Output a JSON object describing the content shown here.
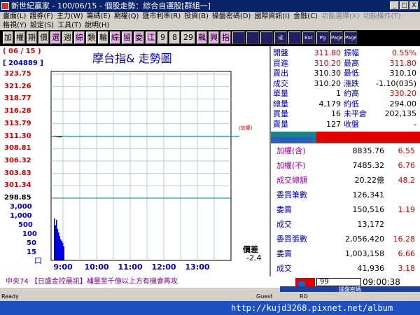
{
  "window": {
    "title": "新世紀贏家 - 100/06/15 - 個股走勢：綜合自選股[群組一]",
    "controls": [
      "_",
      "□",
      "X"
    ]
  },
  "menu_row1": [
    "畫面(L)",
    "證券(F)",
    "主力(W)",
    "籌碼(E)",
    "期權(Q)",
    "匯市利率(R)",
    "投資(B)",
    "操盤密碼(D)",
    "國際資訊(I)",
    "金融(C)",
    "功能選擇(X)",
    "功能操作(T)"
  ],
  "menu_row2": [
    "格視(Y)",
    "設定(S)",
    "工具(T)",
    "說明(H)"
  ],
  "toolbar": {
    "buttons": [
      "加",
      "權",
      "期",
      "價",
      "選",
      "週",
      "綜",
      "類",
      "輪",
      "綜",
      "留",
      "委",
      "江",
      "9",
      "8",
      "29",
      "飆",
      "興",
      "指",
      "",
      "",
      "",
      "成",
      "",
      "Esc",
      "Pg",
      "Page",
      "Page"
    ]
  },
  "chart": {
    "date": "( 06 / 15 )",
    "title": "摩台指&  走勢圖",
    "code": "[ 204889 ]",
    "ref_label": "(加權)",
    "right_label": "價差",
    "right_value": "-2.4",
    "vol_unit": "口"
  },
  "chart_data": {
    "type": "line",
    "title": "摩台指&  走勢圖",
    "y_ticks": [
      "323.75",
      "321.26",
      "318.77",
      "316.28",
      "313.79",
      "311.30",
      "308.81",
      "306.32",
      "303.83",
      "301.34",
      "298.85"
    ],
    "ylim": [
      298.85,
      323.75
    ],
    "reference_price": 311.3,
    "x_ticks": [
      "9:00",
      "10:00",
      "11:00",
      "12:00",
      "13:00"
    ],
    "price_series": [
      {
        "t": "8:46",
        "v": 311.3
      },
      {
        "t": "8:50",
        "v": 311.25
      },
      {
        "t": "8:55",
        "v": 311.1
      },
      {
        "t": "9:00",
        "v": 311.2
      }
    ],
    "volume_ticks": [
      "3,000",
      "1,000",
      "500",
      "100",
      "50",
      "15"
    ],
    "volume_series": [
      60,
      50,
      58,
      45,
      40,
      35,
      30,
      28,
      25,
      20
    ]
  },
  "quote": {
    "rows": [
      {
        "l1": "開盤",
        "v1": "311.80",
        "l2": "振幅",
        "v2": "0.55%"
      },
      {
        "l1": "買進",
        "v1": "310.20",
        "l2": "最高",
        "v2": "311.80"
      },
      {
        "l1": "賣出",
        "v1": "310.30",
        "l2": "最低",
        "v2": "310.10"
      },
      {
        "l1": "成交",
        "v1": "310.20",
        "l2": "漲跌",
        "v2": "-1.10(035)"
      },
      {
        "l1": "單量",
        "v1": "1",
        "l2": "約高",
        "v2": "330.20"
      },
      {
        "l1": "總量",
        "v1": "4,179",
        "l2": "約低",
        "v2": "294.00"
      },
      {
        "l1": "買量",
        "v1": "16",
        "l2": "未平倉",
        "v2": "202,135"
      },
      {
        "l1": "賣量",
        "v1": "127",
        "l2": "收盤",
        "v2": "-"
      }
    ]
  },
  "index": {
    "rows": [
      {
        "label": "加權(含)",
        "value": "8835.76",
        "chg": "6.55"
      },
      {
        "label": "加權(不)",
        "value": "7485.32",
        "chg": "6.76"
      },
      {
        "label": "成交總額",
        "value": "20.22億",
        "chg": "48.2"
      },
      {
        "label": "委買筆數",
        "value": "126,341",
        "chg": ""
      },
      {
        "label": "委賣",
        "value": "150,516",
        "chg": "1.19"
      },
      {
        "label": "成交",
        "value": "13,172",
        "chg": ""
      },
      {
        "label": "委買張數",
        "value": "2,056,420",
        "chg": "16.28"
      },
      {
        "label": "委賣",
        "value": "1,003,158",
        "chg": "6.66"
      },
      {
        "label": "成交",
        "value": "41,936",
        "chg": "3.18"
      }
    ]
  },
  "news": {
    "text": "中央74  【日盛金控晨訊】補量至千億以上方有機會再攻"
  },
  "clock": {
    "field": "99",
    "time": "09:00:38"
  },
  "operate_label": "操盤密碼",
  "statusbar": {
    "left": "Ready",
    "mid1": "Guest",
    "mid2": "RO"
  },
  "watermark": "http://kujd3268.pixnet.net/album",
  "colors": {
    "accent_red": "#d00000",
    "accent_blue": "#0000c0",
    "grid": "#b0d0d0",
    "ref_line": "#008080"
  }
}
